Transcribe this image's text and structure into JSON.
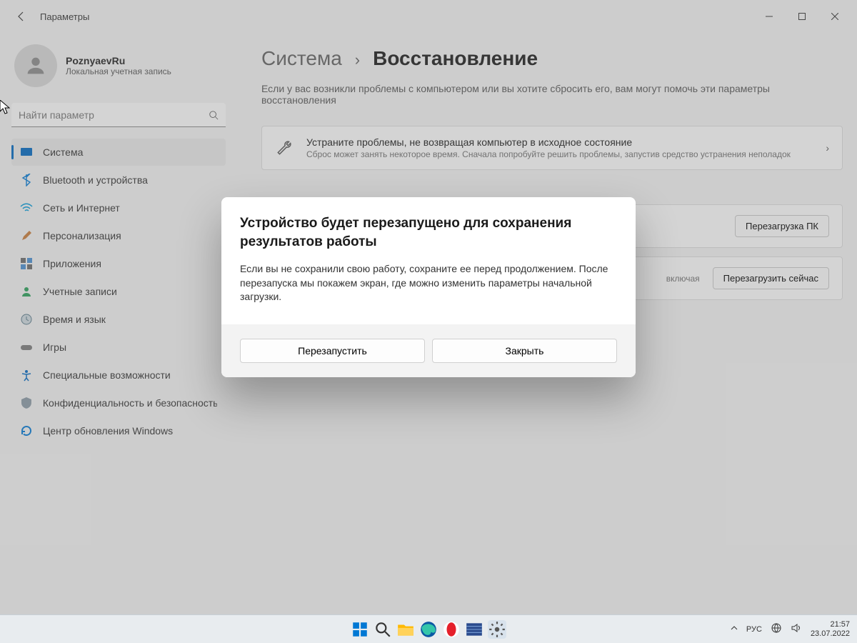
{
  "titlebar": {
    "title": "Параметры"
  },
  "user": {
    "name": "PoznyaevRu",
    "sub": "Локальная учетная запись"
  },
  "search": {
    "placeholder": "Найти параметр"
  },
  "nav": {
    "items": [
      {
        "id": "system",
        "label": "Система"
      },
      {
        "id": "bluetooth",
        "label": "Bluetooth и устройства"
      },
      {
        "id": "network",
        "label": "Сеть и Интернет"
      },
      {
        "id": "personalization",
        "label": "Персонализация"
      },
      {
        "id": "apps",
        "label": "Приложения"
      },
      {
        "id": "accounts",
        "label": "Учетные записи"
      },
      {
        "id": "time",
        "label": "Время и язык"
      },
      {
        "id": "gaming",
        "label": "Игры"
      },
      {
        "id": "accessibility",
        "label": "Специальные возможности"
      },
      {
        "id": "privacy",
        "label": "Конфиденциальность и безопасность"
      },
      {
        "id": "update",
        "label": "Центр обновления Windows"
      }
    ]
  },
  "breadcrumb": {
    "parent": "Система",
    "sep": "›",
    "current": "Восстановление"
  },
  "main_desc": "Если у вас возникли проблемы с компьютером или вы хотите сбросить его, вам могут помочь эти параметры восстановления",
  "cards": {
    "troubleshoot": {
      "title": "Устраните проблемы, не возвращая компьютер в исходное состояние",
      "sub": "Сброс может занять некоторое время. Сначала попробуйте решить проблемы, запустив средство устранения неполадок"
    },
    "reset": {
      "action": "Перезагрузка ПК"
    },
    "advanced": {
      "sub_tail": "включая",
      "action": "Перезагрузить сейчас"
    }
  },
  "dialog": {
    "title": "Устройство будет перезапущено для сохранения результатов работы",
    "text": "Если вы не сохранили свою работу, сохраните ее перед продолжением. После перезапуска мы покажем экран, где можно изменить параметры начальной загрузки.",
    "restart": "Перезапустить",
    "close": "Закрыть"
  },
  "tray": {
    "lang": "РУС",
    "time": "21:57",
    "date": "23.07.2022"
  }
}
